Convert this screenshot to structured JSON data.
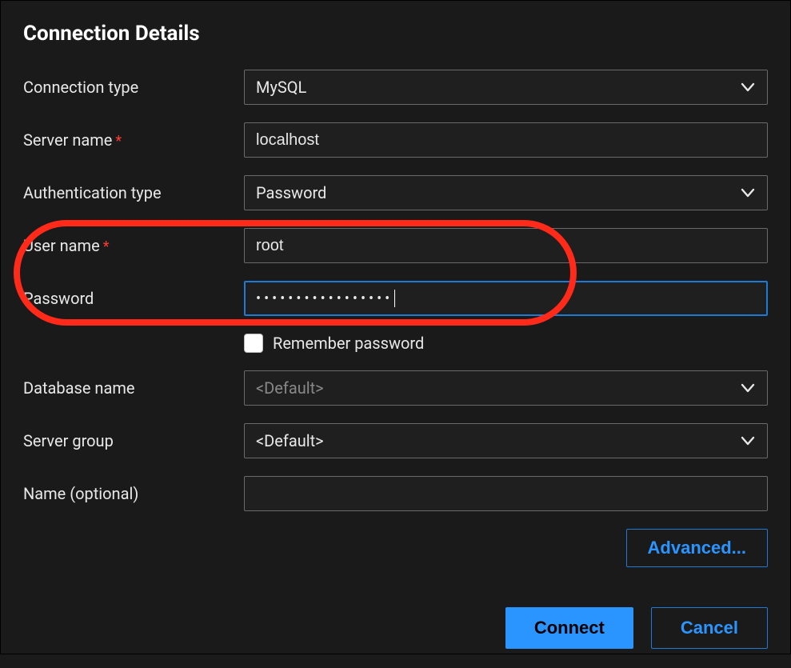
{
  "title": "Connection Details",
  "labels": {
    "connection_type": "Connection type",
    "server_name": "Server name",
    "auth_type": "Authentication type",
    "user_name": "User name",
    "password": "Password",
    "remember": "Remember password",
    "database_name": "Database name",
    "server_group": "Server group",
    "name_optional": "Name (optional)"
  },
  "values": {
    "connection_type": "MySQL",
    "server_name": "localhost",
    "auth_type": "Password",
    "user_name": "root",
    "password_mask": "•••••••••••••••••",
    "database_name": "<Default>",
    "server_group": "<Default>",
    "name_optional": ""
  },
  "buttons": {
    "advanced": "Advanced...",
    "connect": "Connect",
    "cancel": "Cancel"
  }
}
